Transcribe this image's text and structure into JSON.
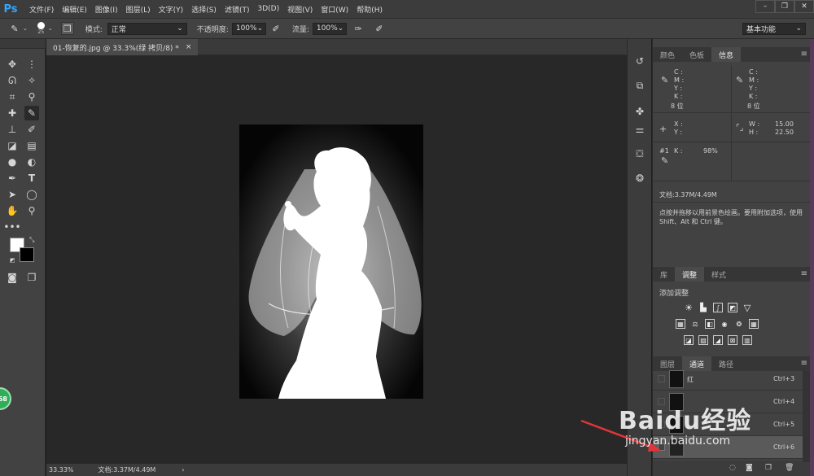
{
  "app": {
    "logo": "Ps"
  },
  "menu": [
    "文件(F)",
    "编辑(E)",
    "图像(I)",
    "图层(L)",
    "文字(Y)",
    "选择(S)",
    "滤镜(T)",
    "3D(D)",
    "视图(V)",
    "窗口(W)",
    "帮助(H)"
  ],
  "window_controls": {
    "minimize": "–",
    "restore": "❐",
    "close": "✕"
  },
  "options": {
    "brush_size": "25",
    "mode_label": "模式:",
    "mode_value": "正常",
    "opacity_label": "不透明度:",
    "opacity_value": "100%",
    "flow_label": "流量:",
    "flow_value": "100%",
    "workspace": "基本功能"
  },
  "document": {
    "tab_title": "01-恢复的.jpg @ 33.3%(绿 拷贝/8) *",
    "close": "×",
    "zoom": "33.33%",
    "doc_size": "文档:3.37M/4.49M",
    "status_arrow": "›"
  },
  "panels": {
    "top_tabs": [
      "颜色",
      "色板",
      "信息"
    ],
    "info": {
      "cmyk_left": [
        "C :",
        "M :",
        "Y :",
        "K :"
      ],
      "cmyk_right": [
        "C :",
        "M :",
        "Y :",
        "K :"
      ],
      "bit_left": "8 位",
      "bit_right": "8 位",
      "xy": [
        "X :",
        "Y :"
      ],
      "w_label": "W :",
      "w_value": "15.00",
      "h_label": "H :",
      "h_value": "22.50",
      "sample_id": "#1",
      "sample_k_label": "K :",
      "sample_k_value": "98%",
      "doc_size": "文档:3.37M/4.49M",
      "hint": "点按并拖移以用前景色绘画。要用附加选项，使用 Shift、Alt 和 Ctrl 键。"
    },
    "mid_tabs": [
      "库",
      "调整",
      "样式"
    ],
    "adjust_title": "添加调整",
    "bottom_tabs": [
      "图层",
      "通道",
      "路径"
    ],
    "channels": [
      {
        "name": "红",
        "shortcut": "Ctrl+3"
      },
      {
        "name": "",
        "shortcut": "Ctrl+4"
      },
      {
        "name": "",
        "shortcut": "Ctrl+5"
      },
      {
        "name": "",
        "shortcut": "Ctrl+6"
      }
    ]
  },
  "watermark": {
    "text": "Baidu经验",
    "sub": "jingyan.baidu.com"
  },
  "badge": "68",
  "colors": {
    "accent": "#31a8ff",
    "arrow": "#e0343a"
  }
}
